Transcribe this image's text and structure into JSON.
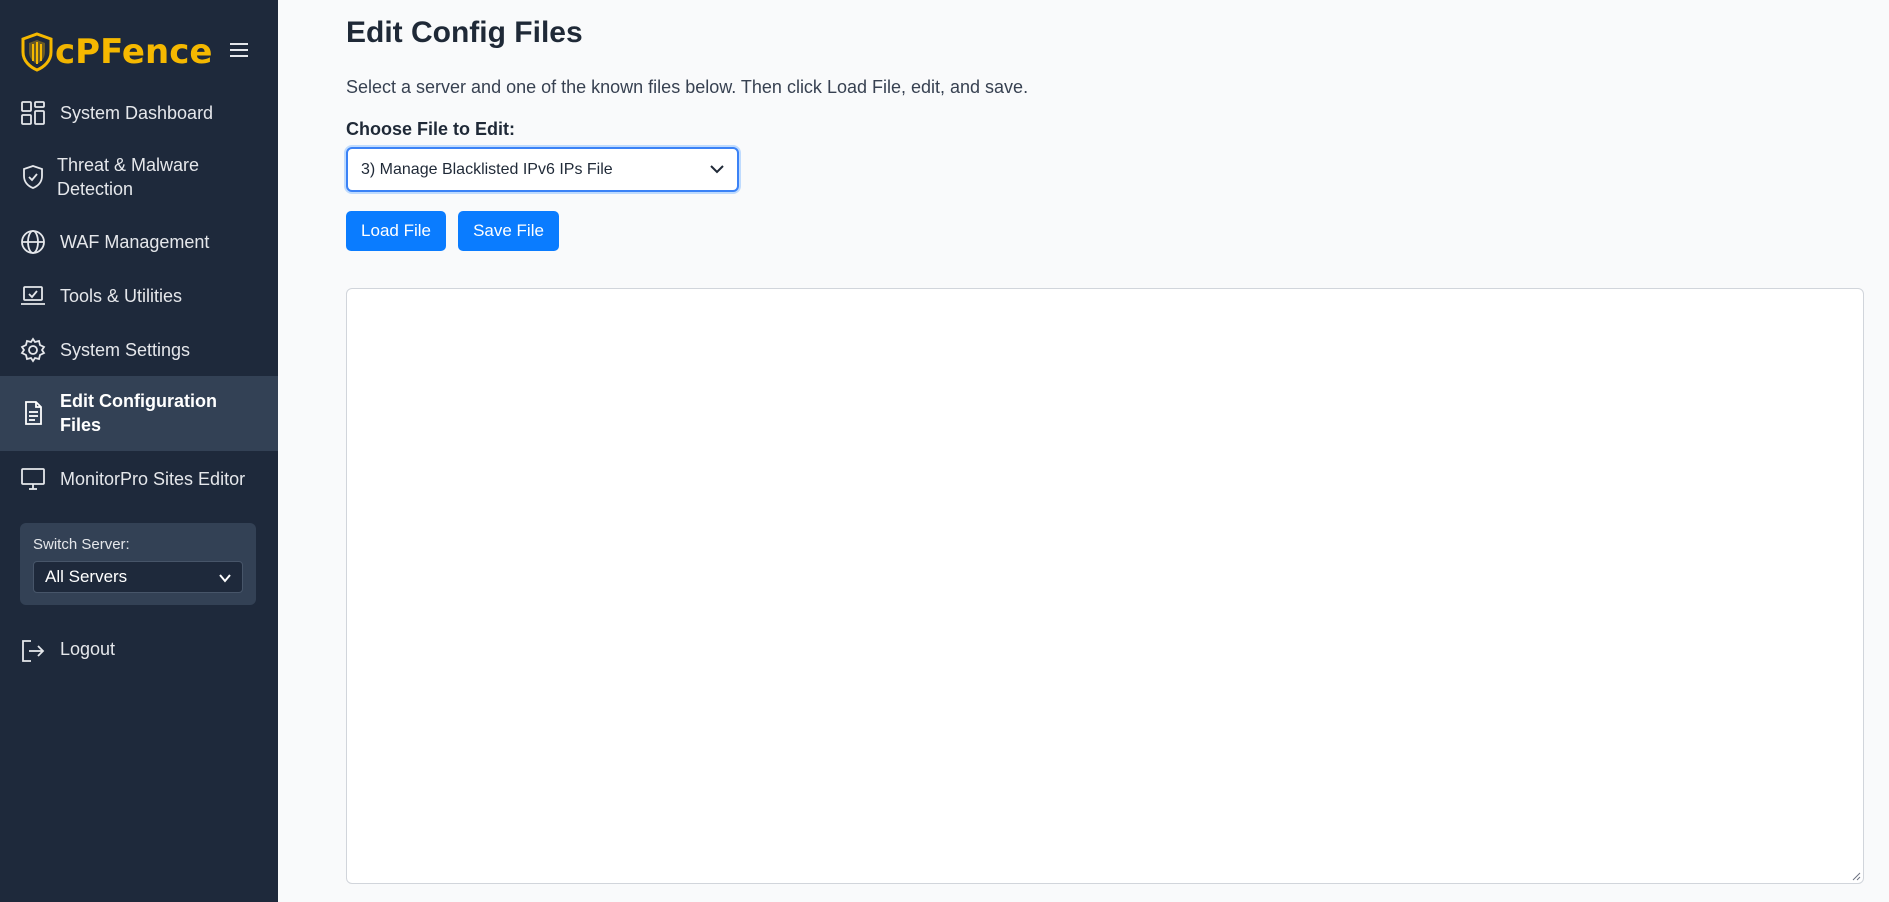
{
  "brand": {
    "logo_text_c": "c",
    "logo_text_rest": "PFence",
    "accent_color": "#f5b800"
  },
  "sidebar": {
    "menu_icon": "hamburger-icon",
    "items": [
      {
        "label": "System Dashboard",
        "icon": "dashboard-grid-icon",
        "active": false
      },
      {
        "label": "Threat & Malware\nDetection",
        "icon": "shield-check-icon",
        "active": false
      },
      {
        "label": "WAF Management",
        "icon": "globe-icon",
        "active": false
      },
      {
        "label": "Tools & Utilities",
        "icon": "laptop-check-icon",
        "active": false
      },
      {
        "label": "System Settings",
        "icon": "gear-icon",
        "active": false
      },
      {
        "label": "Edit Configuration\nFiles",
        "icon": "document-icon",
        "active": true
      },
      {
        "label": "MonitorPro Sites Editor",
        "icon": "monitor-icon",
        "active": false
      }
    ],
    "switch_server": {
      "label": "Switch Server:",
      "selected": "All Servers"
    },
    "logout_label": "Logout"
  },
  "main": {
    "title": "Edit Config Files",
    "description": "Select a server and one of the known files below. Then click Load File, edit, and save.",
    "choose_label": "Choose File to Edit:",
    "file_select_value": "3) Manage Blacklisted IPv6 IPs File",
    "load_button": "Load File",
    "save_button": "Save File",
    "editor_value": ""
  },
  "colors": {
    "sidebar_bg": "#1e293b",
    "sidebar_active_bg": "#334155",
    "button_blue": "#0a7cff",
    "page_bg": "#f9fafb"
  }
}
